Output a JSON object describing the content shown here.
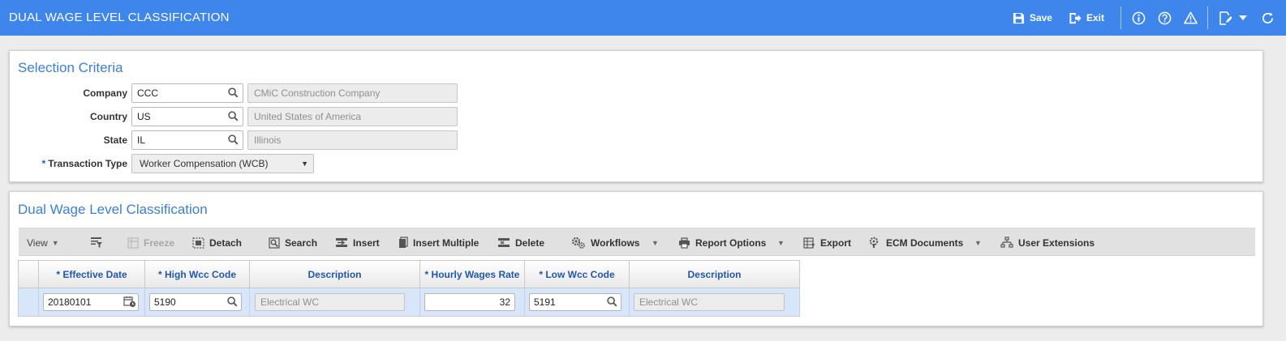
{
  "header": {
    "title": "DUAL WAGE LEVEL CLASSIFICATION",
    "save_label": "Save",
    "exit_label": "Exit",
    "bg_color": "#3f86ec"
  },
  "selection": {
    "title": "Selection Criteria",
    "company": {
      "label": "Company",
      "value": "CCC",
      "description": "CMiC Construction Company"
    },
    "country": {
      "label": "Country",
      "value": "US",
      "description": "United States of America"
    },
    "state": {
      "label": "State",
      "value": "IL",
      "description": "Illinois"
    },
    "transaction_type": {
      "required": "*",
      "label": "Transaction Type",
      "value": "Worker Compensation (WCB)"
    }
  },
  "grid_panel": {
    "title": "Dual Wage Level Classification",
    "toolbar": {
      "view": "View",
      "freeze": "Freeze",
      "detach": "Detach",
      "search": "Search",
      "insert": "Insert",
      "insert_multiple": "Insert Multiple",
      "delete": "Delete",
      "workflows": "Workflows",
      "report_options": "Report Options",
      "export": "Export",
      "ecm_documents": "ECM Documents",
      "user_extensions": "User Extensions"
    },
    "columns": [
      "* Effective Date",
      "* High Wcc Code",
      "Description",
      "* Hourly Wages Rate",
      "* Low Wcc Code",
      "Description"
    ],
    "rows": [
      {
        "effective_date": "20180101",
        "high_wcc_code": "5190",
        "high_description": "Electrical WC",
        "hourly_wages_rate": "32",
        "low_wcc_code": "5191",
        "low_description": "Electrical WC"
      }
    ]
  }
}
